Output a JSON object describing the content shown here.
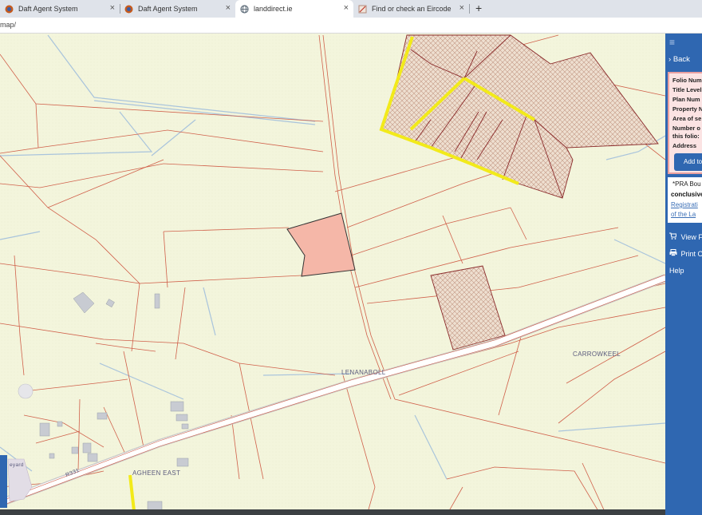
{
  "browser": {
    "tabs": [
      {
        "title": "Daft Agent System",
        "active": false
      },
      {
        "title": "Daft Agent System",
        "active": false
      },
      {
        "title": "landdirect.ie",
        "active": true
      },
      {
        "title": "Find or check an Eircode",
        "active": false
      }
    ],
    "close_glyph": "×",
    "new_tab_glyph": "+",
    "url": "map/"
  },
  "map": {
    "labels": {
      "lenanaboll": "LENANABOLL",
      "carrowkeel": "CARROWKEEL",
      "agheen_east": "AGHEEN EAST",
      "road": "R331",
      "fragment": "eyard"
    },
    "colors": {
      "background": "#f3f5dc",
      "boundary": "#d0604a",
      "selected_parcel": "#f5b7a8",
      "highlight": "#f2ea1a",
      "hatch_parcel": "#e7d3c2"
    }
  },
  "panel": {
    "menu_icon": "≡",
    "back_label": "Back",
    "info_lines": [
      "Folio Num",
      "Title Level",
      "Plan Num",
      "Property N",
      "Area of se",
      "Number o",
      "this folio:",
      "Address"
    ],
    "add_button": "Add to",
    "notice": {
      "line1": "*PRA Bou",
      "line2": "conclusive",
      "link1": "Registrati",
      "link2": "of the La"
    },
    "links": [
      {
        "icon": "cart-icon",
        "label": "View F"
      },
      {
        "icon": "print-icon",
        "label": "Print O"
      }
    ],
    "help_label": "Help"
  }
}
